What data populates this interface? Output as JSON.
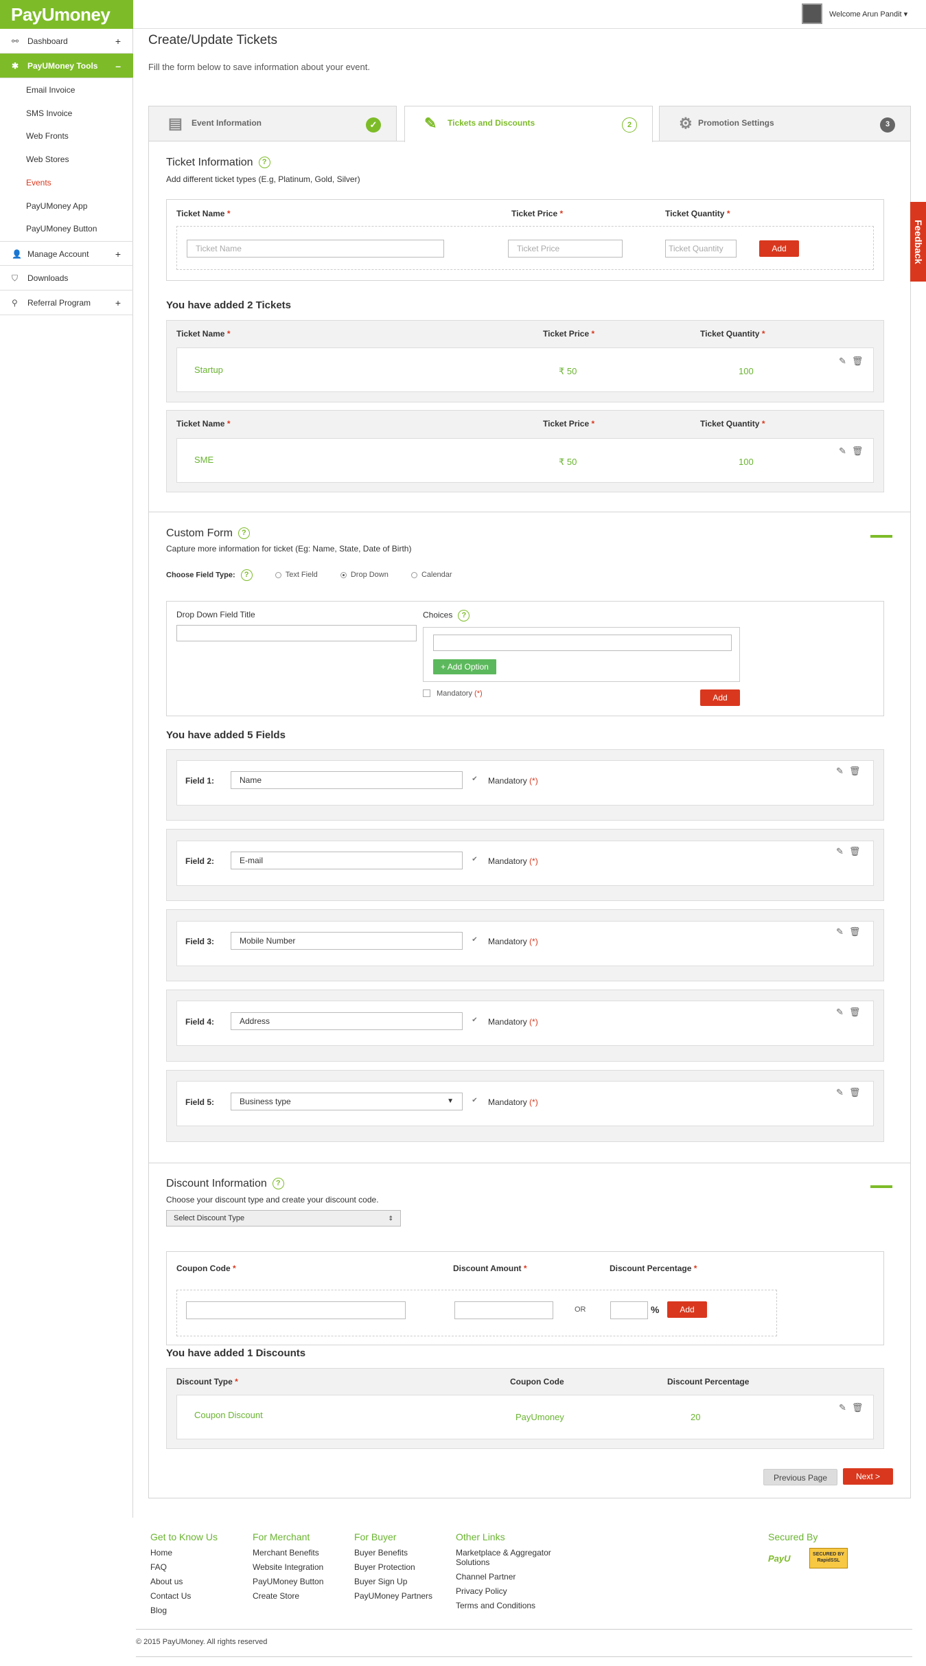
{
  "brand": {
    "logo_text": "PayUmoney",
    "secured_logo": "PayU",
    "ssl_badge": "SECURED BY RapidSSL"
  },
  "header": {
    "welcome": "Welcome Arun Pandit"
  },
  "sidebar": {
    "dashboard": "Dashboard",
    "tools": "PayUMoney Tools",
    "tools_items": [
      "Email Invoice",
      "SMS Invoice",
      "Web Fronts",
      "Web Stores",
      "Events",
      "PayUMoney App",
      "PayUMoney Button"
    ],
    "manage": "Manage Account",
    "downloads": "Downloads",
    "referral": "Referral Program",
    "plus": "+",
    "minus": "–"
  },
  "page": {
    "title": "Create/Update Tickets",
    "intro": "Fill the form below to save information about your event."
  },
  "tabs": [
    {
      "label": "Event Information",
      "badge": "✓"
    },
    {
      "label": "Tickets and Discounts",
      "badge": "2"
    },
    {
      "label": "Promotion Settings",
      "badge": "3"
    }
  ],
  "ticket_info": {
    "title": "Ticket Information",
    "subtitle": "Add different ticket types (E.g, Platinum, Gold, Silver)",
    "name_label": "Ticket Name",
    "price_label": "Ticket Price",
    "qty_label": "Ticket Quantity",
    "name_ph": "Ticket Name",
    "price_ph": "Ticket Price",
    "qty_ph": "Ticket Quantity",
    "add": "Add",
    "help": "?",
    "req": "*"
  },
  "tickets": {
    "heading": "You have added 2 Tickets",
    "rows": [
      {
        "name": "Startup",
        "price": "₹ 50",
        "qty": "100"
      },
      {
        "name": "SME",
        "price": "₹ 50",
        "qty": "100"
      }
    ]
  },
  "custom_form": {
    "title": "Custom Form",
    "subtitle": "Capture more information for ticket (Eg: Name, State, Date of Birth)",
    "field_type_label": "Choose Field Type:",
    "types": [
      "Text Field",
      "Drop Down",
      "Calendar"
    ],
    "dd_title_label": "Drop Down Field Title",
    "choices_label": "Choices",
    "add_option": "+ Add Option",
    "mandatory": "Mandatory",
    "req_star": "(*)",
    "add": "Add"
  },
  "fields": {
    "heading": "You have added 5 Fields",
    "rows": [
      {
        "label": "Field 1:",
        "value": "Name"
      },
      {
        "label": "Field 2:",
        "value": "E-mail"
      },
      {
        "label": "Field 3:",
        "value": "Mobile Number"
      },
      {
        "label": "Field 4:",
        "value": "Address"
      },
      {
        "label": "Field 5:",
        "value": "Business type"
      }
    ]
  },
  "discount": {
    "title": "Discount Information",
    "subtitle": "Choose your discount type and create your discount code.",
    "select": "Select Discount Type",
    "coupon_label": "Coupon Code",
    "amount_label": "Discount Amount",
    "pct_label": "Discount Percentage",
    "or": "OR",
    "pct_sign": "%",
    "add": "Add",
    "heading": "You have added 1 Discounts",
    "type_label": "Discount Type",
    "code_label": "Coupon Code",
    "pct_col": "Discount Percentage",
    "row": {
      "type": "Coupon Discount",
      "code": "PayUmoney",
      "pct": "20"
    }
  },
  "nav_buttons": {
    "prev": "Previous Page",
    "next": "Next  >"
  },
  "feedback": "Feedback",
  "footer": {
    "cols": [
      {
        "title": "Get to Know Us",
        "links": [
          "Home",
          "FAQ",
          "About us",
          "Contact Us",
          "Blog"
        ]
      },
      {
        "title": "For Merchant",
        "links": [
          "Merchant Benefits",
          "Website Integration",
          "PayUMoney Button",
          "Create Store"
        ]
      },
      {
        "title": "For Buyer",
        "links": [
          "Buyer Benefits",
          "Buyer Protection",
          "Buyer Sign Up",
          "PayUMoney Partners"
        ]
      },
      {
        "title": "Other Links",
        "links": [
          "Marketplace & Aggregator Solutions",
          "Channel Partner",
          "Privacy Policy",
          "Terms and Conditions"
        ]
      }
    ],
    "secured": "Secured By",
    "copyright": "© 2015 PayUMoney. All rights reserved"
  },
  "colors": {
    "brand_green": "#7dbc28",
    "accent_red": "#d9381e"
  }
}
